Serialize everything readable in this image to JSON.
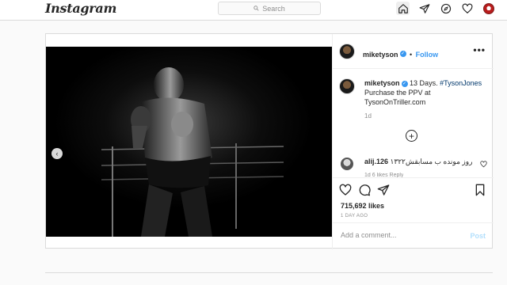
{
  "nav": {
    "logo": "Instagram",
    "search_placeholder": "Search",
    "icons": [
      "home-icon",
      "direct-icon",
      "explore-icon",
      "activity-heart-icon",
      "profile-avatar"
    ]
  },
  "post": {
    "username": "miketyson",
    "follow_label": "Follow",
    "follow_separator": "•",
    "more_label": "•••",
    "caption": {
      "username": "miketyson",
      "text_before": "13 Days. ",
      "hashtag": "#TysonJones",
      "text_after": "Purchase the PPV at TysonOnTriller.com"
    },
    "caption_time": "1d",
    "comments": [
      {
        "username": "alij.126",
        "text": "روز مونده ب مسابقش۱۳۲۲",
        "meta": "1d   6 likes   Reply"
      }
    ],
    "likes": "715,692 likes",
    "date": "1 DAY AGO",
    "comment_placeholder": "Add a comment...",
    "post_label": "Post",
    "carousel": {
      "total": 2,
      "active": 2
    }
  },
  "colors": {
    "accent": "#3897f0",
    "link": "#00376b",
    "muted": "#8e8e8e",
    "post_disabled": "#b2dffc"
  }
}
